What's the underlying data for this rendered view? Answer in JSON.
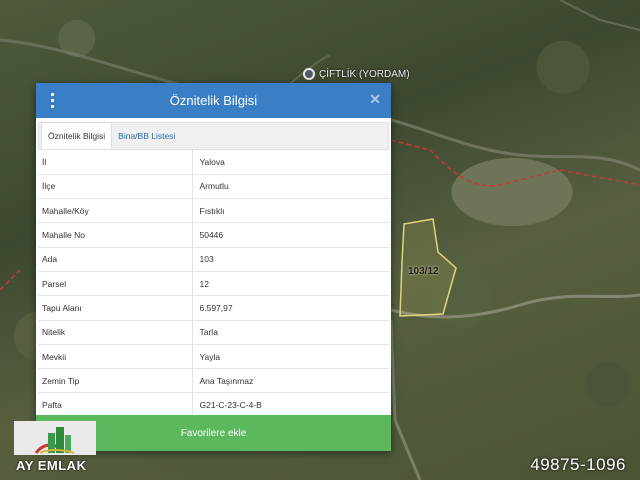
{
  "map": {
    "poi_label": "ÇİFTLİK (YORDAM)",
    "parcel_label": "103/12",
    "road_colors": {
      "boundary": "#c23a3a",
      "parcel_outline": "#e3d27a"
    }
  },
  "dialog": {
    "title": "Öznitelik Bilgisi",
    "menu_icon": "kebab-menu-icon",
    "close_icon": "close-icon",
    "tabs": [
      {
        "label": "Öznitelik Bilgisi",
        "active": true
      },
      {
        "label": "Bina/BB Listesi",
        "active": false
      }
    ],
    "rows": [
      {
        "key": "İl",
        "value": "Yalova"
      },
      {
        "key": "İlçe",
        "value": "Armutlu"
      },
      {
        "key": "Mahalle/Köy",
        "value": "Fıstıklı"
      },
      {
        "key": "Mahalle No",
        "value": "50446"
      },
      {
        "key": "Ada",
        "value": "103"
      },
      {
        "key": "Parsel",
        "value": "12"
      },
      {
        "key": "Tapu Alanı",
        "value": "6.597,97"
      },
      {
        "key": "Nitelik",
        "value": "Tarla"
      },
      {
        "key": "Mevkii",
        "value": "Yayla"
      },
      {
        "key": "Zemin Tip",
        "value": "Ana Taşınmaz"
      },
      {
        "key": "Pafta",
        "value": "G21-C-23-C-4-B"
      }
    ],
    "favorite_button": "Favorilere ekle",
    "colors": {
      "header": "#3a7fc6",
      "button": "#5cb85c"
    }
  },
  "watermark": {
    "logo_text": "AY EMLAK",
    "ref_number": "49875-1096"
  }
}
